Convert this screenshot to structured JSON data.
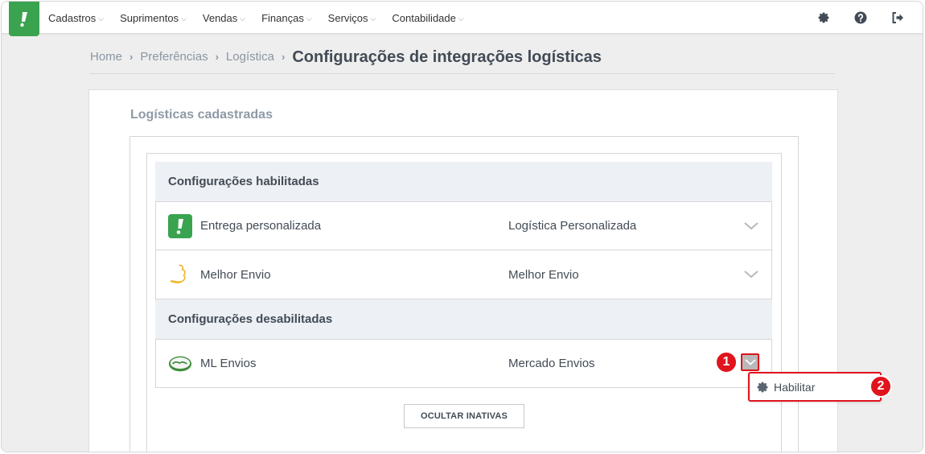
{
  "nav": {
    "items": [
      {
        "label": "Cadastros"
      },
      {
        "label": "Suprimentos"
      },
      {
        "label": "Vendas"
      },
      {
        "label": "Finanças"
      },
      {
        "label": "Serviços"
      },
      {
        "label": "Contabilidade"
      }
    ],
    "icons": [
      "gear-icon",
      "help-icon",
      "logout-icon"
    ]
  },
  "breadcrumb": {
    "items": [
      "Home",
      "Preferências",
      "Logística"
    ],
    "current": "Configurações de integrações logísticas"
  },
  "panel": {
    "title": "Logísticas cadastradas",
    "enabled_header": "Configurações habilitadas",
    "disabled_header": "Configurações desabilitadas",
    "enabled_rows": [
      {
        "name": "Entrega personalizada",
        "type": "Logística Personalizada",
        "icon": "bling-logo-icon"
      },
      {
        "name": "Melhor Envio",
        "type": "Melhor Envio",
        "icon": "melhor-envio-logo-icon"
      }
    ],
    "disabled_rows": [
      {
        "name": "ML Envios",
        "type": "Mercado Envios",
        "icon": "mercado-envios-logo-icon"
      }
    ],
    "hide_button": "OCULTAR INATIVAS"
  },
  "dropdown": {
    "enable_label": "Habilitar"
  },
  "annotations": {
    "badge1": "1",
    "badge2": "2"
  },
  "colors": {
    "brand_green": "#3aa34f",
    "annotation_red": "#e0141c",
    "header_bg": "#edf0f4"
  }
}
